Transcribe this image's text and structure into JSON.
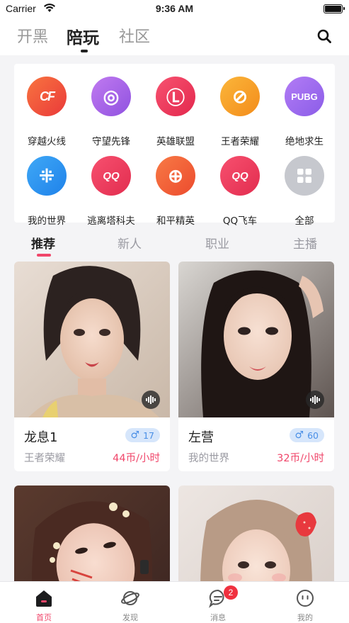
{
  "status_bar": {
    "carrier": "Carrier",
    "time": "9:36 AM"
  },
  "top_nav": {
    "tabs": [
      "开黑",
      "陪玩",
      "社区"
    ],
    "active_index": 1
  },
  "categories": [
    {
      "label": "穿越火线",
      "icon": "crossfire-icon",
      "color": "#f2553a",
      "glyph": "CF"
    },
    {
      "label": "守望先锋",
      "icon": "overwatch-icon",
      "color": "#b164e8",
      "glyph": "◎"
    },
    {
      "label": "英雄联盟",
      "icon": "lol-icon",
      "color": "#ef3b5b",
      "glyph": "Ⓛ"
    },
    {
      "label": "王者荣耀",
      "icon": "honor-of-kings-icon",
      "color": "#f7a126",
      "glyph": "⊘"
    },
    {
      "label": "绝地求生",
      "icon": "pubg-icon",
      "color": "#a66ef0",
      "glyph": "PUBG"
    },
    {
      "label": "我的世界",
      "icon": "minecraft-icon",
      "color": "#2f98f2",
      "glyph": "⁜"
    },
    {
      "label": "逃离塔科夫",
      "icon": "tarkov-icon",
      "color": "#ef3a5d",
      "glyph": "QQ"
    },
    {
      "label": "和平精英",
      "icon": "peacekeeper-icon",
      "color": "#f25e3a",
      "glyph": "⊕"
    },
    {
      "label": "QQ飞车",
      "icon": "qq-speed-icon",
      "color": "#ef3a5d",
      "glyph": "QQ"
    },
    {
      "label": "全部",
      "icon": "all-grid-icon",
      "color": "#c6c8ce",
      "glyph": "▦"
    }
  ],
  "filter_tabs": [
    "推荐",
    "新人",
    "职业",
    "主播"
  ],
  "cards": [
    {
      "name": "龙息1",
      "age": "17",
      "game": "王者荣耀",
      "price": "44币/小时"
    },
    {
      "name": "左营",
      "age": "60",
      "game": "我的世界",
      "price": "32币/小时"
    },
    {
      "name": "",
      "age": "",
      "game": "",
      "price": ""
    },
    {
      "name": "",
      "age": "",
      "game": "",
      "price": ""
    }
  ],
  "bottom_bar": {
    "items": [
      "首页",
      "发现",
      "消息",
      "我的"
    ],
    "active_index": 0,
    "message_badge": "2"
  },
  "colors": {
    "accent": "#f0466a",
    "male_badge": "#4a8fe6"
  }
}
